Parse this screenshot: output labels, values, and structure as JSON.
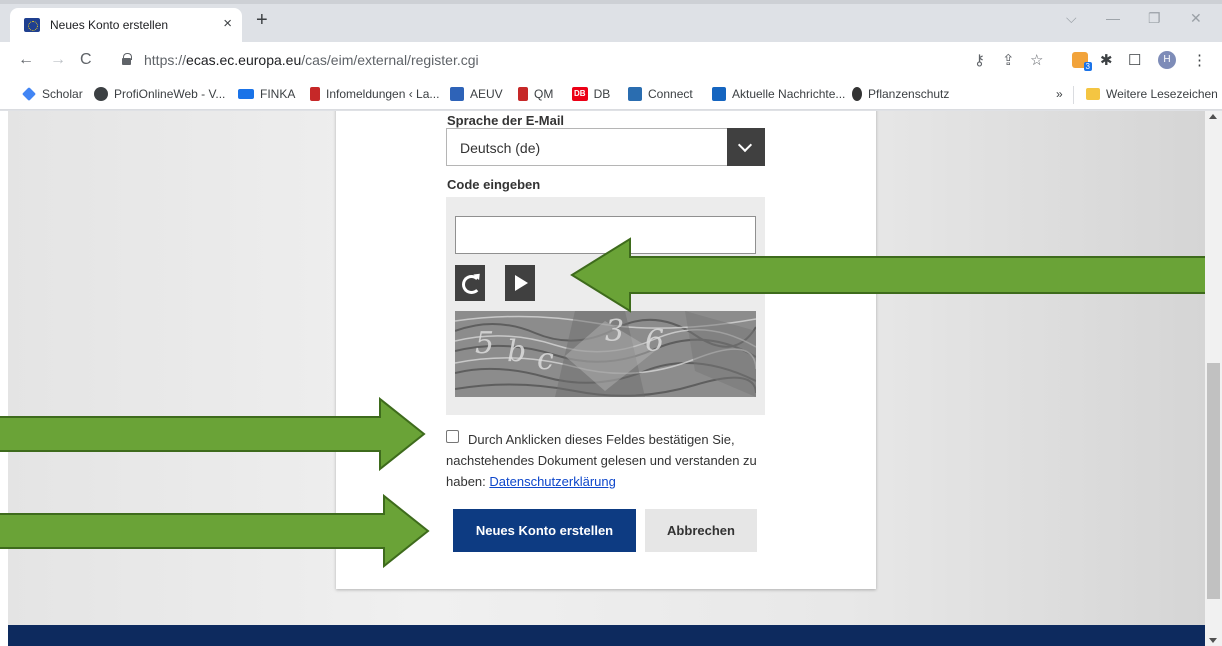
{
  "browser": {
    "tab_title": "Neues Konto erstellen",
    "tab_close": "×",
    "new_tab": "+",
    "url_prefix": "https://",
    "url_host": "ecas.ec.europa.eu",
    "url_path": "/cas/eim/external/register.cgi",
    "rss_badge": "3",
    "profile_initial": "H"
  },
  "bookmarks": {
    "items": [
      {
        "label": "Scholar",
        "color": "#4285f4"
      },
      {
        "label": "ProfiOnlineWeb - V...",
        "color": "#3c4043"
      },
      {
        "label": "FINKA",
        "color": "#1a73e8"
      },
      {
        "label": "Infomeldungen ‹ La...",
        "color": "#c62828"
      },
      {
        "label": "AEUV",
        "color": "#2e63b8"
      },
      {
        "label": "QM",
        "color": "#c62828"
      },
      {
        "label": "DB",
        "color": "#ec0016",
        "icon_text": "DB"
      },
      {
        "label": "Connect",
        "color": "#2a6db0"
      },
      {
        "label": "Aktuelle Nachrichte...",
        "color": "#1565c0"
      },
      {
        "label": "Pflanzenschutz",
        "color": "#333333"
      }
    ],
    "more": "»",
    "other": "Weitere Lesezeichen"
  },
  "form": {
    "email_language_label": "Sprache der E-Mail",
    "email_language_value": "Deutsch (de)",
    "code_label": "Code eingeben",
    "code_value": "",
    "consent_text": "Durch Anklicken dieses Feldes bestätigen Sie, nachstehendes Dokument gelesen und verstanden zu haben:",
    "privacy_link": "Datenschutzerklärung",
    "create_button": "Neues Konto erstellen",
    "cancel_button": "Abbrechen"
  },
  "colors": {
    "primary_button": "#0d3b82",
    "arrow_fill": "#6aa337",
    "arrow_stroke": "#3e6b1c",
    "footer": "#0d2a5e"
  }
}
